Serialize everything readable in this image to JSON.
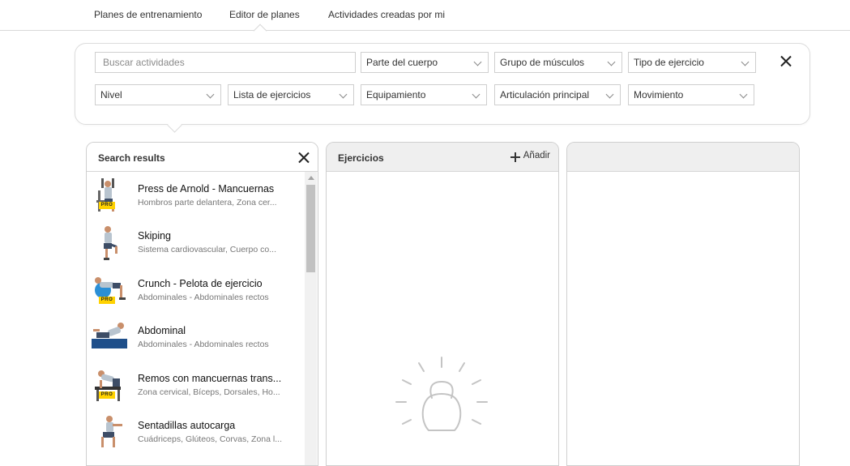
{
  "nav": {
    "tabs": [
      {
        "label": "Planes de entrenamiento"
      },
      {
        "label": "Editor de planes"
      },
      {
        "label": "Actividades creadas por mi"
      }
    ]
  },
  "filters": {
    "search_placeholder": "Buscar actividades",
    "dropdowns": [
      {
        "label": "Parte del cuerpo"
      },
      {
        "label": "Grupo de músculos"
      },
      {
        "label": "Tipo de ejercicio"
      },
      {
        "label": "Nivel"
      },
      {
        "label": "Lista de ejercicios"
      },
      {
        "label": "Equipamiento"
      },
      {
        "label": "Articulación principal"
      },
      {
        "label": "Movimiento"
      }
    ],
    "close_icon": "close-icon"
  },
  "results": {
    "title": "Search results",
    "items": [
      {
        "title": "Press de Arnold - Mancuernas",
        "subtitle": "Hombros parte delantera, Zona cer...",
        "badge": "PRO"
      },
      {
        "title": "Skiping",
        "subtitle": "Sistema cardiovascular, Cuerpo co...",
        "badge": ""
      },
      {
        "title": "Crunch - Pelota de ejercicio",
        "subtitle": "Abdominales - Abdominales rectos",
        "badge": "PRO"
      },
      {
        "title": "Abdominal",
        "subtitle": "Abdominales - Abdominales rectos",
        "badge": ""
      },
      {
        "title": "Remos con mancuernas trans...",
        "subtitle": "Zona cervical, Bíceps, Dorsales, Ho...",
        "badge": "PRO"
      },
      {
        "title": "Sentadillas autocarga",
        "subtitle": "Cuádriceps, Glúteos, Corvas, Zona l...",
        "badge": ""
      }
    ]
  },
  "ejercicios": {
    "title": "Ejercicios",
    "add_label": "Añadir"
  },
  "colors": {
    "border": "#cfcfcf",
    "header_gray": "#efefef",
    "pro_badge": "#ffd200",
    "ball_blue": "#2b8fd6",
    "mat_blue": "#1f4f8a"
  }
}
